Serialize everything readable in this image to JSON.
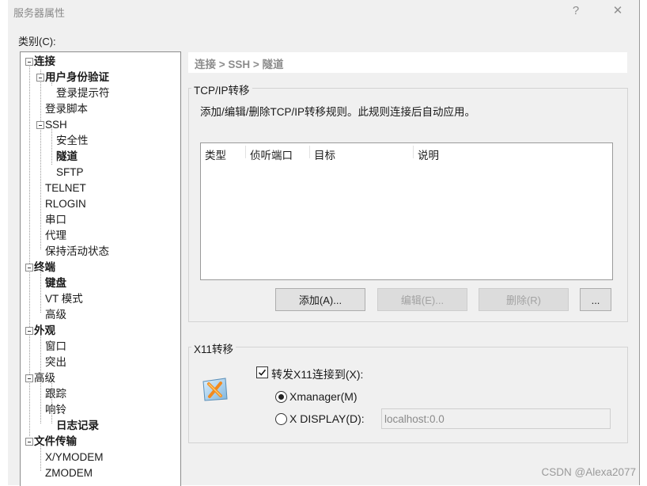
{
  "window": {
    "title": "服务器属性",
    "help_glyph": "?",
    "close_glyph": "✕"
  },
  "category": {
    "label": "类别(C):"
  },
  "tree": [
    {
      "label": "连接",
      "bold": true
    },
    {
      "label": "用户身份验证",
      "bold": true
    },
    {
      "label": "登录提示符",
      "bold": false
    },
    {
      "label": "登录脚本",
      "bold": false
    },
    {
      "label": "SSH",
      "bold": false
    },
    {
      "label": "安全性",
      "bold": false
    },
    {
      "label": "隧道",
      "bold": true
    },
    {
      "label": "SFTP",
      "bold": false
    },
    {
      "label": "TELNET",
      "bold": false
    },
    {
      "label": "RLOGIN",
      "bold": false
    },
    {
      "label": "串口",
      "bold": false
    },
    {
      "label": "代理",
      "bold": false
    },
    {
      "label": "保持活动状态",
      "bold": false
    },
    {
      "label": "终端",
      "bold": true
    },
    {
      "label": "键盘",
      "bold": true
    },
    {
      "label": "VT 模式",
      "bold": false
    },
    {
      "label": "高级",
      "bold": false
    },
    {
      "label": "外观",
      "bold": true
    },
    {
      "label": "窗口",
      "bold": false
    },
    {
      "label": "突出",
      "bold": false
    },
    {
      "label": "高级",
      "bold": false
    },
    {
      "label": "跟踪",
      "bold": false
    },
    {
      "label": "响铃",
      "bold": false
    },
    {
      "label": "日志记录",
      "bold": true
    },
    {
      "label": "文件传输",
      "bold": true
    },
    {
      "label": "X/YMODEM",
      "bold": false
    },
    {
      "label": "ZMODEM",
      "bold": false
    }
  ],
  "breadcrumb": "连接 > SSH > 隧道",
  "tcp": {
    "group_label": "TCP/IP转移",
    "description": "添加/编辑/删除TCP/IP转移规则。此规则连接后自动应用。",
    "columns": [
      "类型",
      "侦听端口",
      "目标",
      "说明"
    ],
    "rows": [],
    "buttons": {
      "add": "添加(A)...",
      "edit": "编辑(E)...",
      "delete": "删除(R)",
      "more": "..."
    }
  },
  "x11": {
    "group_label": "X11转移",
    "forward_label": "转发X11连接到(X):",
    "forward_checked": true,
    "xmanager_label": "Xmanager(M)",
    "xdisplay_label": "X DISPLAY(D):",
    "selected": "Xmanager(M)",
    "xdisplay_value": "localhost:0.0"
  },
  "watermark": "CSDN @Alexa2077"
}
